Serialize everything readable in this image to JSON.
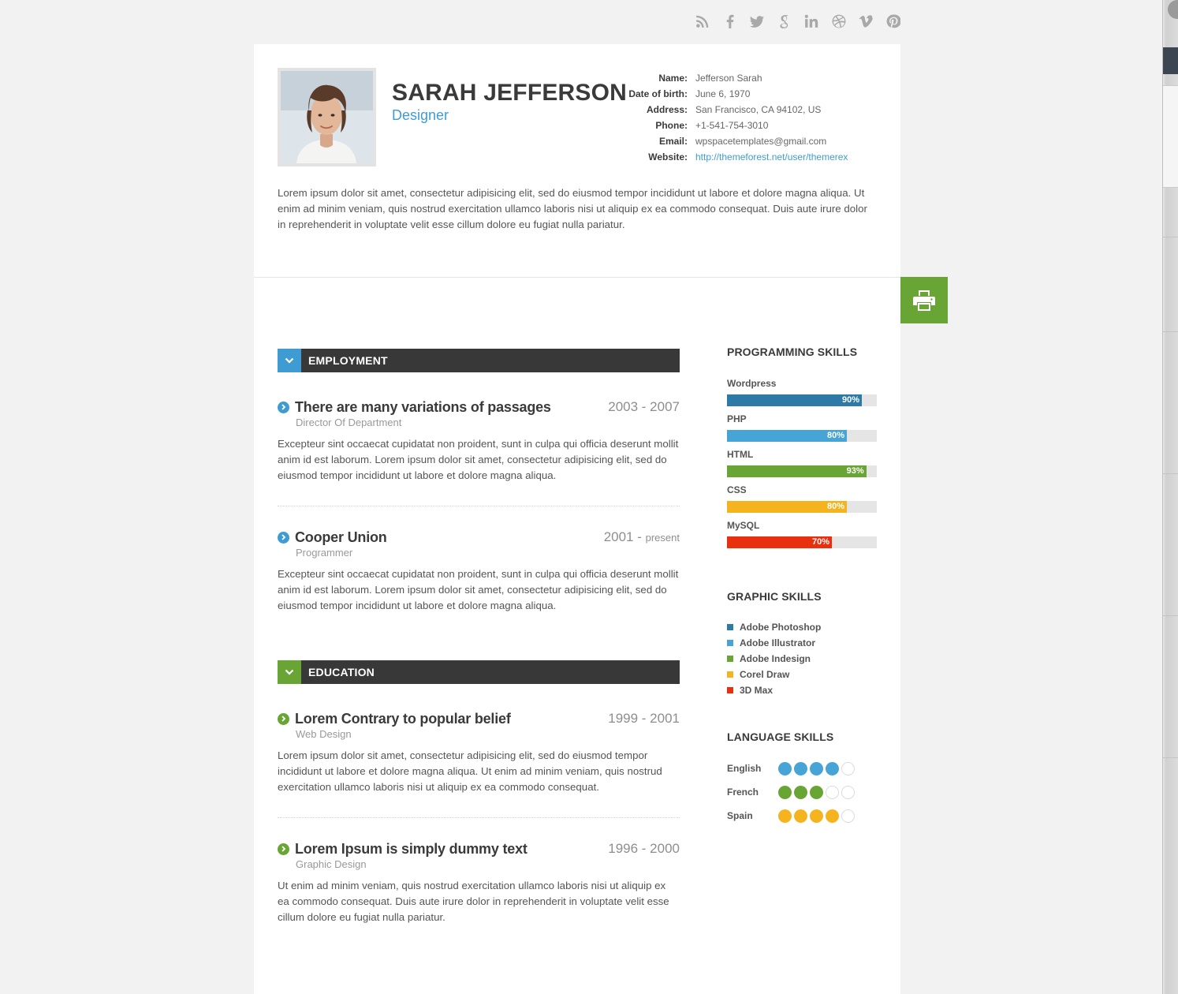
{
  "social": [
    "rss-icon",
    "facebook-icon",
    "twitter-icon",
    "google-plus-icon",
    "linkedin-icon",
    "dribbble-icon",
    "vimeo-icon",
    "pinterest-icon"
  ],
  "profile": {
    "name": "SARAH JEFFERSON",
    "role": "Designer",
    "info": [
      {
        "label": "Name:",
        "value": "Jefferson Sarah"
      },
      {
        "label": "Date of birth:",
        "value": "June 6, 1970"
      },
      {
        "label": "Address:",
        "value": "San Francisco, CA 94102, US"
      },
      {
        "label": "Phone:",
        "value": "+1-541-754-3010"
      },
      {
        "label": "Email:",
        "value": "wpspacetemplates@gmail.com"
      },
      {
        "label": "Website:",
        "value": "http://themeforest.net/user/themerex"
      }
    ],
    "intro": "Lorem ipsum dolor sit amet, consectetur adipisicing elit, sed do eiusmod tempor incididunt ut labore et dolore magna aliqua. Ut enim ad minim veniam, quis nostrud exercitation ullamco laboris nisi ut aliquip ex ea commodo consequat. Duis aute irure dolor in reprehenderit in voluptate velit esse cillum dolore eu fugiat nulla pariatur."
  },
  "print_button": "print-icon",
  "employment": {
    "title": "EMPLOYMENT",
    "color": "#3e9cd2",
    "entries": [
      {
        "title": "There are many variations of passages",
        "dates": "2003 - 2007",
        "dates_suffix": "",
        "sub": "Director Of Department",
        "desc": "Excepteur sint occaecat cupidatat non proident, sunt in culpa qui officia deserunt mollit anim id est laborum. Lorem ipsum dolor sit amet, consectetur adipisicing elit, sed do eiusmod tempor incididunt ut labore et dolore magna aliqua."
      },
      {
        "title": "Cooper Union",
        "dates": "2001 - ",
        "dates_suffix": "present",
        "sub": "Programmer",
        "desc": "Excepteur sint occaecat cupidatat non proident, sunt in culpa qui officia deserunt mollit anim id est laborum. Lorem ipsum dolor sit amet, consectetur adipisicing elit, sed do eiusmod tempor incididunt ut labore et dolore magna aliqua."
      }
    ]
  },
  "education": {
    "title": "EDUCATION",
    "color": "#69a534",
    "entries": [
      {
        "title": "Lorem Contrary to popular belief",
        "dates": "1999 - 2001",
        "dates_suffix": "",
        "sub": "Web Design",
        "desc": "Lorem ipsum dolor sit amet, consectetur adipisicing elit, sed do eiusmod tempor incididunt ut labore et dolore magna aliqua. Ut enim ad minim veniam, quis nostrud exercitation ullamco laboris nisi ut aliquip ex ea commodo consequat."
      },
      {
        "title": "Lorem Ipsum is simply dummy text",
        "dates": "1996 - 2000",
        "dates_suffix": "",
        "sub": "Graphic Design",
        "desc": "Ut enim ad minim veniam, quis nostrud exercitation ullamco laboris nisi ut aliquip ex ea commodo consequat. Duis aute irure dolor in reprehenderit in voluptate velit esse cillum dolore eu fugiat nulla pariatur."
      }
    ]
  },
  "programming_skills": {
    "title": "PROGRAMMING SKILLS",
    "items": [
      {
        "name": "Wordpress",
        "percent": 90,
        "label": "90%",
        "color": "#2e7aa6"
      },
      {
        "name": "PHP",
        "percent": 80,
        "label": "80%",
        "color": "#47a4d6"
      },
      {
        "name": "HTML",
        "percent": 93,
        "label": "93%",
        "color": "#69a534"
      },
      {
        "name": "CSS",
        "percent": 80,
        "label": "80%",
        "color": "#f5b41f"
      },
      {
        "name": "MySQL",
        "percent": 70,
        "label": "70%",
        "color": "#e8300e"
      }
    ]
  },
  "graphic_skills": {
    "title": "GRAPHIC SKILLS",
    "items": [
      {
        "name": "Adobe Photoshop",
        "color": "#2e7aa6"
      },
      {
        "name": "Adobe Illustrator",
        "color": "#47a4d6"
      },
      {
        "name": "Adobe Indesign",
        "color": "#69a534"
      },
      {
        "name": "Corel Draw",
        "color": "#f5b41f"
      },
      {
        "name": "3D Max",
        "color": "#e8300e"
      }
    ]
  },
  "language_skills": {
    "title": "LANGUAGE SKILLS",
    "items": [
      {
        "name": "English",
        "level": 4,
        "max": 5,
        "color": "#47a4d6"
      },
      {
        "name": "French",
        "level": 3,
        "max": 5,
        "color": "#69a534"
      },
      {
        "name": "Spain",
        "level": 4,
        "max": 5,
        "color": "#f5b41f"
      }
    ]
  }
}
